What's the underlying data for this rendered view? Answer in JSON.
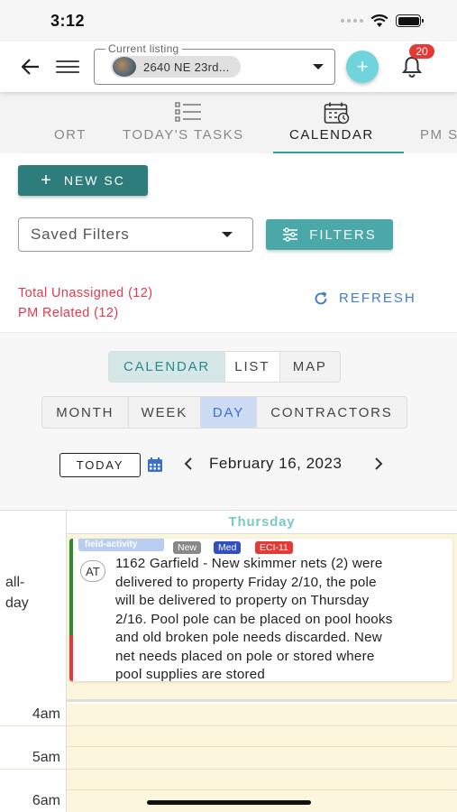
{
  "status": {
    "time": "3:12"
  },
  "header": {
    "listing_label": "Current listing",
    "listing_value": "2640 NE 23rd...",
    "add_symbol": "+",
    "notifications_count": "20"
  },
  "tabs": [
    {
      "label": "ORT",
      "active": false
    },
    {
      "label": "TODAY'S TASKS",
      "active": false
    },
    {
      "label": "CALENDAR",
      "active": true
    },
    {
      "label": "PM S",
      "active": false
    }
  ],
  "toolbar": {
    "new_sc_label": "NEW SC",
    "saved_filters_placeholder": "Saved Filters",
    "filters_label": "FILTERS"
  },
  "summary": {
    "unassigned": "Total Unassigned (12)",
    "pm_related": "PM Related (12)",
    "refresh_label": "REFRESH"
  },
  "view_modes": {
    "options": [
      "CALENDAR",
      "LIST",
      "MAP"
    ],
    "selected": "CALENDAR"
  },
  "range_modes": {
    "options": [
      "MONTH",
      "WEEK",
      "DAY",
      "CONTRACTORS"
    ],
    "selected": "DAY"
  },
  "date_nav": {
    "today_label": "TODAY",
    "current_date": "February 16, 2023"
  },
  "calendar": {
    "day_header": "Thursday",
    "allday_label_1": "all-",
    "allday_label_2": "day",
    "event": {
      "type_tag": "field-activity",
      "badges": [
        "New",
        "Med",
        "ECI-11"
      ],
      "avatar": "AT",
      "lines": [
        "1162 Garfield - New skimmer nets (2) were",
        "delivered to property Friday 2/10, the pole",
        "will be delivered to property on Thursday",
        "2/16. Pool pole can be placed on pool hooks",
        "and old broken pole needs discarded. New",
        "net needs placed on pole or stored where",
        "pool supplies are stored"
      ],
      "colors": {
        "top_bar": "#2e8b2e",
        "bottom_bar": "#e53935"
      }
    },
    "time_slots": [
      "4am",
      "5am",
      "6am"
    ]
  },
  "colors": {
    "teal_primary": "#2e7d7d",
    "teal_light": "#4aa8a8",
    "alert_red": "#e53950",
    "link_blue": "#3f7fd0",
    "slot_bg": "#fcf6dc"
  }
}
